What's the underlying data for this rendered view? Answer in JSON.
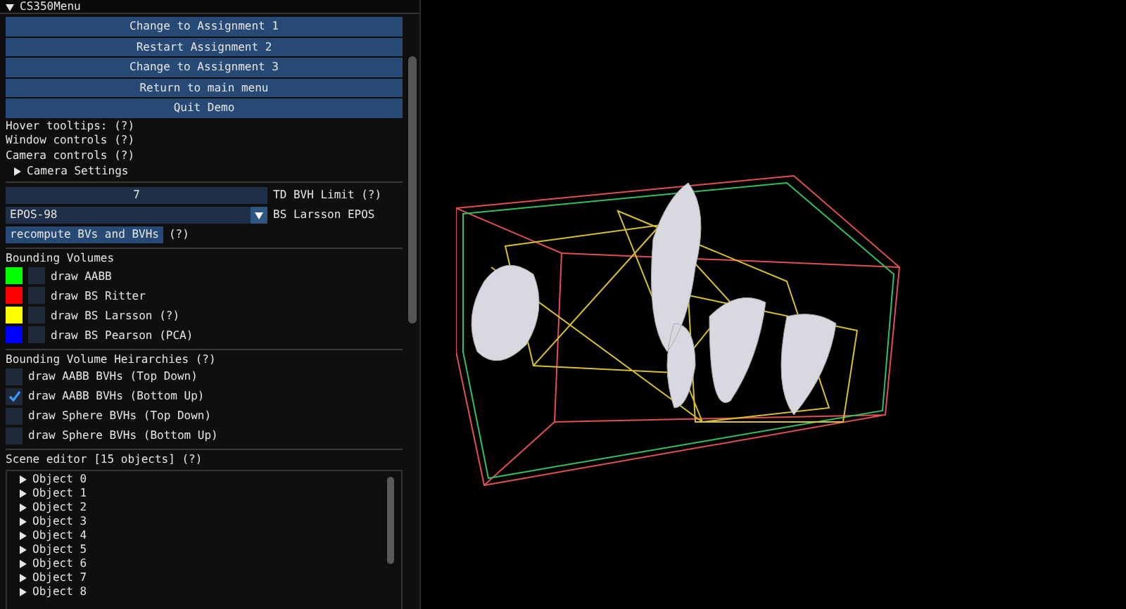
{
  "window": {
    "title": "CS350Menu"
  },
  "buttons": [
    "Change to Assignment 1",
    "Restart Assignment 2",
    "Change to Assignment 3",
    "Return to main menu",
    "Quit Demo"
  ],
  "help_lines": [
    "Hover tooltips: (?)",
    "Window controls (?)",
    "Camera controls (?)"
  ],
  "camera_settings": {
    "label": "Camera Settings",
    "expanded": false
  },
  "bvh_limit": {
    "value": "7",
    "label": "TD BVH Limit (?)"
  },
  "epos_combo": {
    "value": "EPOS-98",
    "label": "BS Larsson EPOS"
  },
  "recompute": {
    "label": "recompute BVs and BVHs",
    "help": "(?)"
  },
  "bounding_volumes": {
    "title": "Bounding Volumes",
    "items": [
      {
        "label": "draw AABB",
        "color": "#00ff00",
        "checked": false
      },
      {
        "label": "draw BS Ritter",
        "color": "#ff0000",
        "checked": false
      },
      {
        "label": "draw BS Larsson (?)",
        "color": "#ffff00",
        "checked": false
      },
      {
        "label": "draw BS Pearson (PCA)",
        "color": "#0000ff",
        "checked": false
      }
    ]
  },
  "hierarchies": {
    "title": "Bounding Volume Heirarchies (?)",
    "items": [
      {
        "label": "draw AABB BVHs (Top Down)",
        "checked": false
      },
      {
        "label": "draw AABB BVHs (Bottom Up)",
        "checked": true
      },
      {
        "label": "draw Sphere BVHs (Top Down)",
        "checked": false
      },
      {
        "label": "draw Sphere BVHs (Bottom Up)",
        "checked": false
      }
    ]
  },
  "scene_editor": {
    "title": "Scene editor [15 objects] (?)",
    "objects": [
      {
        "label": "Object 0",
        "expanded": false
      },
      {
        "label": "Object 1",
        "expanded": false
      },
      {
        "label": "Object 2",
        "expanded": false
      },
      {
        "label": "Object 3",
        "expanded": false
      },
      {
        "label": "Object 4",
        "expanded": false
      },
      {
        "label": "Object 5",
        "expanded": false
      },
      {
        "label": "Object 6",
        "expanded": false
      },
      {
        "label": "Object 7",
        "expanded": false
      },
      {
        "label": "Object 8",
        "expanded": false
      }
    ]
  }
}
